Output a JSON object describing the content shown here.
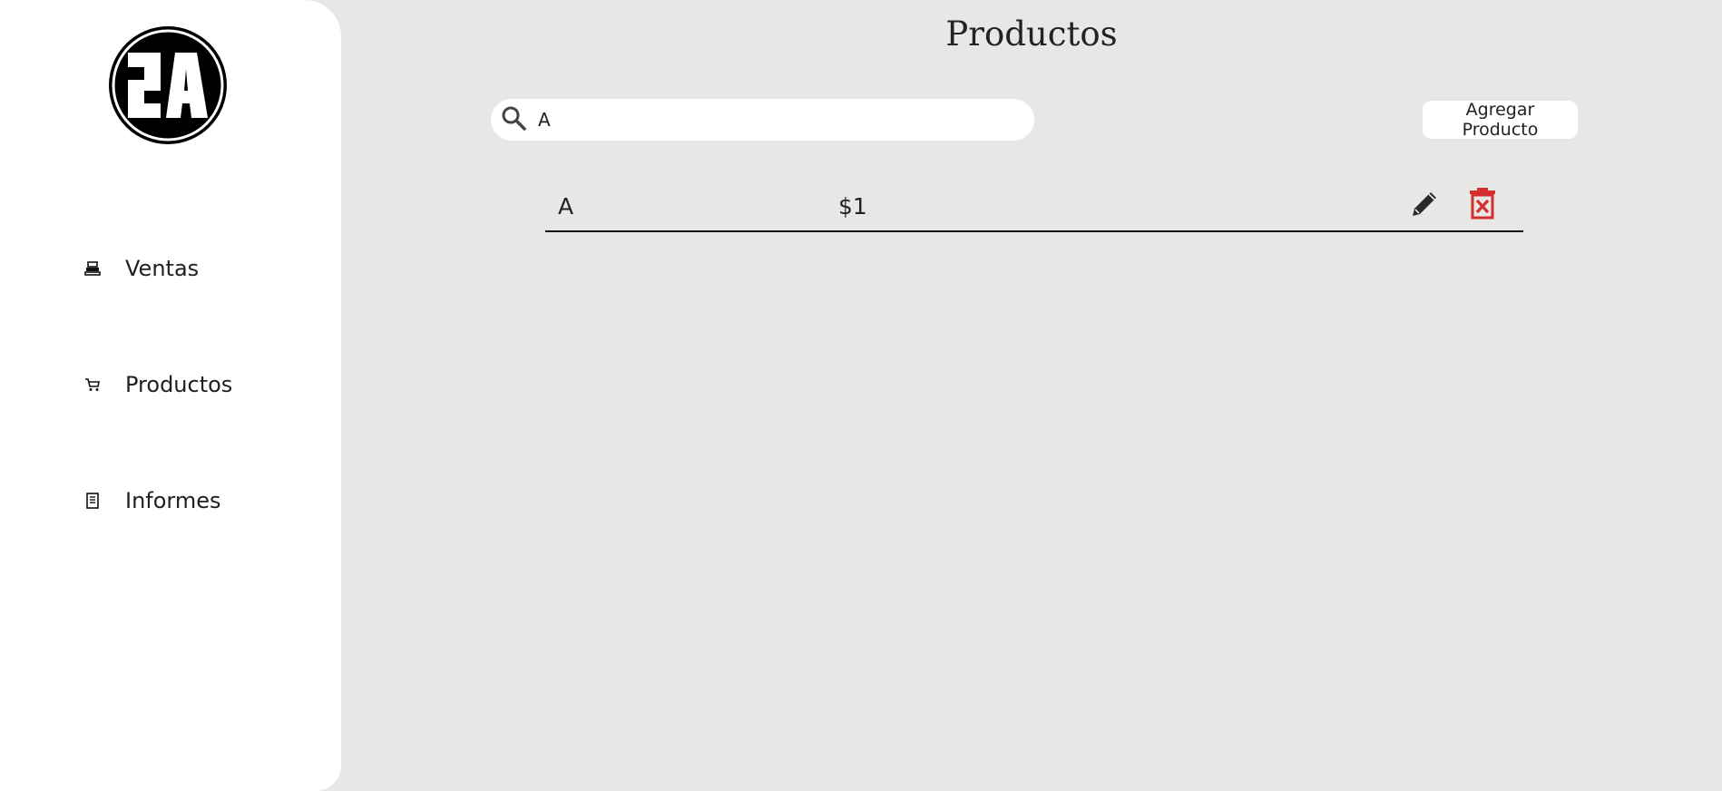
{
  "sidebar": {
    "logo_text": "2A",
    "items": [
      {
        "label": "Ventas",
        "icon": "cash-register-icon"
      },
      {
        "label": "Productos",
        "icon": "cart-icon"
      },
      {
        "label": "Informes",
        "icon": "report-icon"
      }
    ]
  },
  "header": {
    "title": "Productos"
  },
  "search": {
    "value": "A",
    "icon": "search-icon"
  },
  "toolbar": {
    "add_label": "Agregar Producto"
  },
  "products": [
    {
      "name": "A",
      "price": "$1"
    }
  ],
  "colors": {
    "background": "#e9e7e5",
    "sidebar": "#ffffff",
    "delete": "#d32f2f",
    "text": "#222222"
  }
}
